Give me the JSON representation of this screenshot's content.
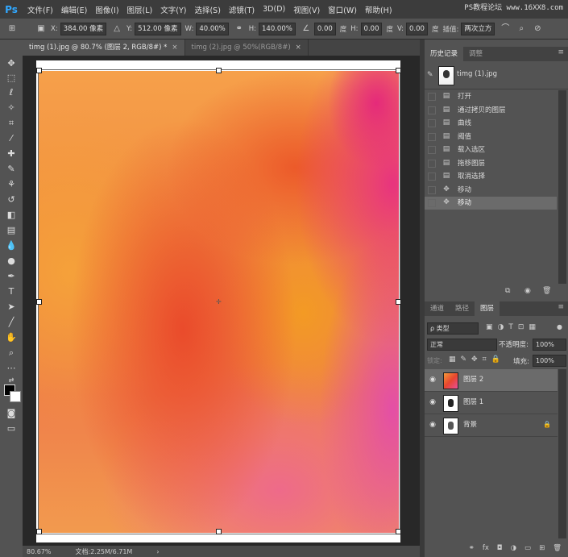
{
  "menubar": {
    "logo": "Ps",
    "items": [
      "文件(F)",
      "编辑(E)",
      "图像(I)",
      "图层(L)",
      "文字(Y)",
      "选择(S)",
      "滤镜(T)",
      "3D(D)",
      "视图(V)",
      "窗口(W)",
      "帮助(H)"
    ],
    "watermark": "PS教程论坛 www.16XX8.com"
  },
  "options": {
    "x_label": "X:",
    "x_value": "384.00 像素",
    "y_label": "Y:",
    "y_value": "512.00 像素",
    "w_label": "W:",
    "w_value": "40.00%",
    "h_label": "H:",
    "h_value": "140.00%",
    "angle_value": "0.00",
    "angle_unit": "度",
    "hskew_label": "H:",
    "hskew_value": "0.00",
    "hskew_unit": "度",
    "vskew_label": "V:",
    "vskew_value": "0.00",
    "vskew_unit": "度",
    "interp_label": "插值:",
    "interp_value": "两次立方"
  },
  "tabs": [
    {
      "label": "timg (1).jpg @ 80.7% (图层 2, RGB/8#) *",
      "close": "×"
    },
    {
      "label": "timg (2).jpg @ 50%(RGB/8#)",
      "close": "×"
    }
  ],
  "status": {
    "zoom": "80.67%",
    "doc": "文档:2.25M/6.71M",
    "arrow": "›"
  },
  "history": {
    "tabs": [
      "历史记录",
      "调整"
    ],
    "snapshot": "timg (1).jpg",
    "items": [
      {
        "label": "打开",
        "icon": "document-icon"
      },
      {
        "label": "通过拷贝的图层",
        "icon": "document-icon"
      },
      {
        "label": "曲线",
        "icon": "document-icon"
      },
      {
        "label": "阈值",
        "icon": "document-icon"
      },
      {
        "label": "载入选区",
        "icon": "document-icon"
      },
      {
        "label": "拖移图层",
        "icon": "document-icon"
      },
      {
        "label": "取消选择",
        "icon": "document-icon"
      },
      {
        "label": "移动",
        "icon": "move-icon"
      },
      {
        "label": "移动",
        "icon": "move-icon"
      }
    ]
  },
  "layers": {
    "tabs": [
      "通道",
      "路径",
      "图层"
    ],
    "filter_label": "ρ 类型",
    "blend_mode": "正常",
    "opacity_label": "不透明度:",
    "opacity_value": "100%",
    "lock_label": "锁定:",
    "fill_label": "填充:",
    "fill_value": "100%",
    "items": [
      {
        "name": "图层 2",
        "selected": true
      },
      {
        "name": "图层 1",
        "selected": false
      },
      {
        "name": "背景",
        "selected": false,
        "locked": true
      }
    ],
    "bottom_icons": [
      "link-icon",
      "fx-icon",
      "mask-icon",
      "adjustment-icon",
      "folder-icon",
      "new-layer-icon",
      "trash-icon"
    ]
  },
  "colors": {
    "accent": "#31a8ff",
    "panel": "#535353",
    "dark": "#282828"
  }
}
